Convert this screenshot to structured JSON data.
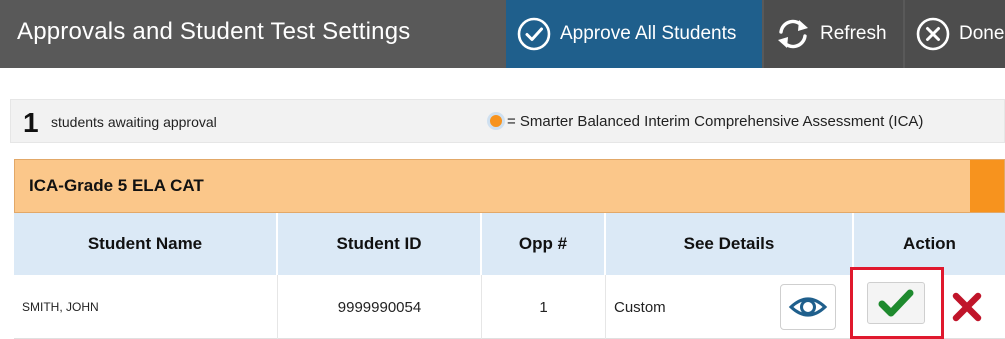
{
  "header": {
    "title": "Approvals and Student Test Settings",
    "approve_all_label": "Approve All Students",
    "refresh_label": "Refresh",
    "done_label": "Done"
  },
  "status": {
    "awaiting_count": "1",
    "awaiting_text": "students awaiting approval",
    "legend_text": "= Smarter Balanced Interim Comprehensive Assessment (ICA)"
  },
  "test_group": {
    "title": "ICA-Grade 5 ELA CAT"
  },
  "table": {
    "headers": [
      "Student Name",
      "Student ID",
      "Opp #",
      "See Details",
      "Action"
    ],
    "rows": [
      {
        "name": "SMITH, JOHN",
        "id": "9999990054",
        "opp": "1",
        "details": "Custom"
      }
    ]
  },
  "colors": {
    "header_bg": "#595959",
    "approve_all_bg": "#1f5f8c",
    "ica_orange": "#f7931e",
    "group_bar_bg": "#fbc78a",
    "table_header_bg": "#dbe9f6",
    "approve_check": "#1e8a2e",
    "deny_x": "#c0152a",
    "highlight_border": "#e0182d"
  },
  "icons": {
    "approve_all": "check-circle-icon",
    "refresh": "refresh-icon",
    "done": "close-circle-icon",
    "legend": "ica-dot-icon",
    "see_details": "eye-icon",
    "approve": "checkmark-icon",
    "deny": "x-icon"
  }
}
